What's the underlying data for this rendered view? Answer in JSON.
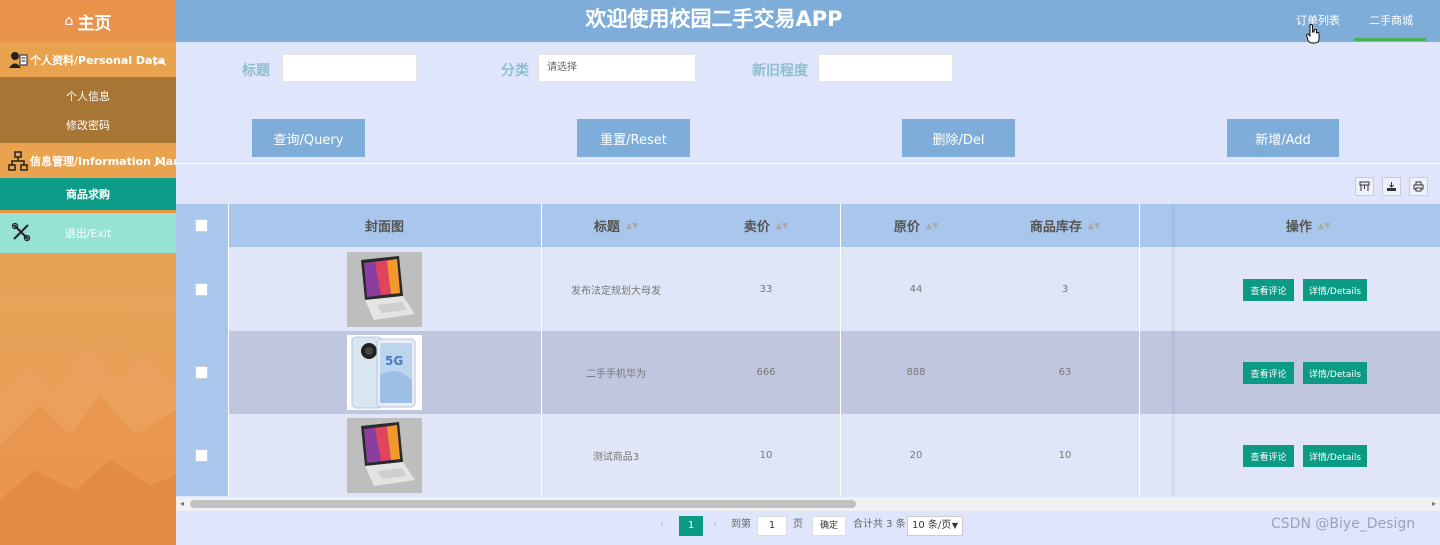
{
  "sidebar": {
    "home": "主页",
    "groups": [
      {
        "label": "个人资料/Personal Data",
        "items": [
          "个人信息",
          "修改密码"
        ]
      },
      {
        "label": "信息管理/Information Manage",
        "items": [
          "商品求购"
        ]
      }
    ],
    "exit": "退出/Exit"
  },
  "header": {
    "title": "欢迎使用校园二手交易APP",
    "nav_orders": "订单列表",
    "nav_market": "二手商城"
  },
  "search": {
    "title_label": "标题",
    "title_value": "",
    "category_label": "分类",
    "category_placeholder": "请选择",
    "condition_label": "新旧程度",
    "condition_value": ""
  },
  "buttons": {
    "query": "查询/Query",
    "reset": "重置/Reset",
    "delete": "删除/Del",
    "add": "新增/Add"
  },
  "table": {
    "columns": [
      "封面图",
      "标题",
      "卖价",
      "原价",
      "商品库存",
      "操作"
    ],
    "rows": [
      {
        "title": "发布法定规划大母发",
        "price": "33",
        "original": "44",
        "stock": "3",
        "image": "laptop"
      },
      {
        "title": "二手手机华为",
        "price": "666",
        "original": "888",
        "stock": "63",
        "image": "phone"
      },
      {
        "title": "测试商品3",
        "price": "10",
        "original": "20",
        "stock": "10",
        "image": "laptop"
      }
    ],
    "op_view_comments": "查看评论",
    "op_details": "详情/Details",
    "phone_badge": "5G"
  },
  "pager": {
    "current": "1",
    "goto_label": "到第",
    "goto_value": "1",
    "page_label": "页",
    "confirm": "确定",
    "total": "合计共 3 条",
    "page_size": "10 条/页"
  },
  "watermark": "CSDN @Biye_Design"
}
